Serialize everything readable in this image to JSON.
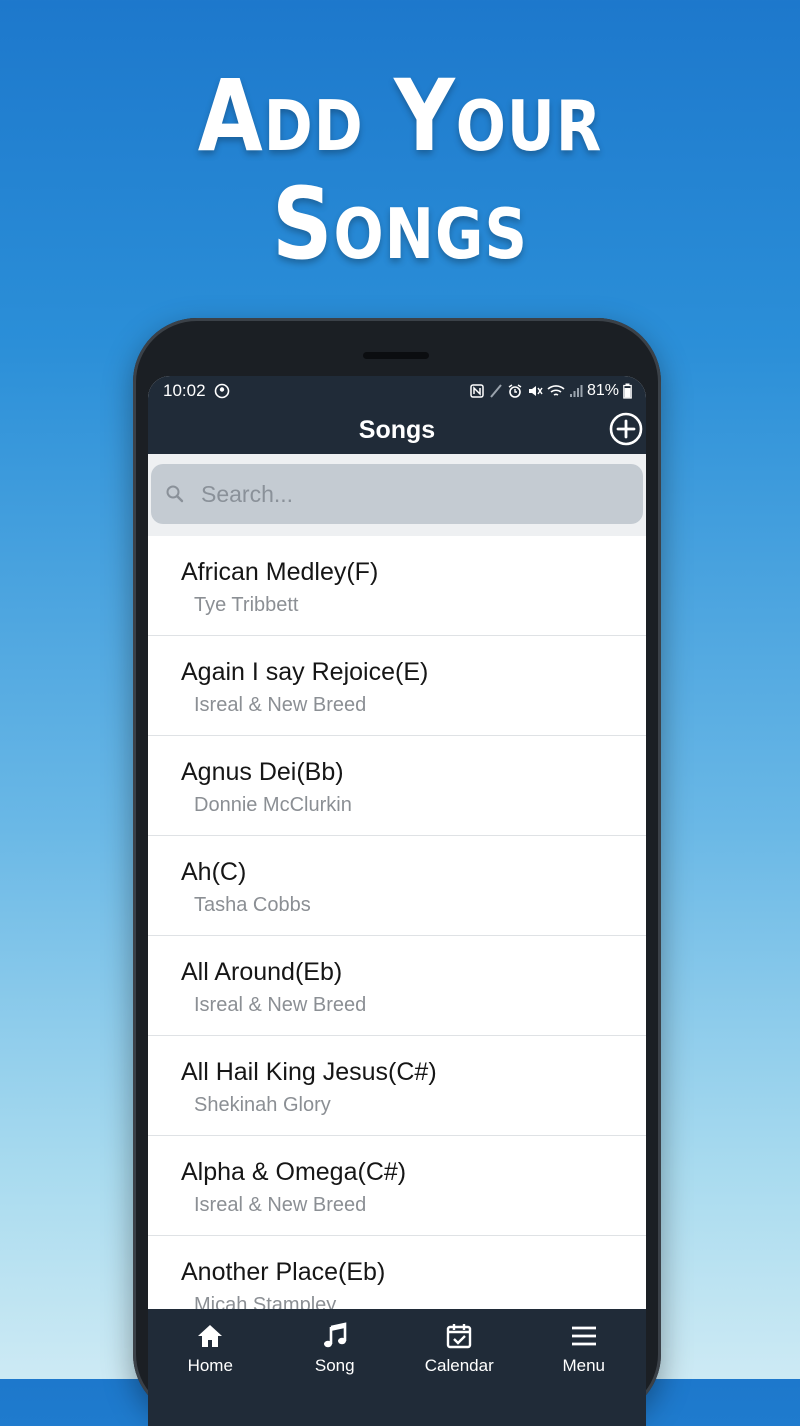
{
  "headline": {
    "line1": "Add Your",
    "line2": "Songs"
  },
  "status": {
    "time": "10:02",
    "battery": "81%"
  },
  "appbar": {
    "title": "Songs"
  },
  "search": {
    "placeholder": "Search..."
  },
  "songs": [
    {
      "title": "African Medley(F)",
      "artist": "Tye Tribbett"
    },
    {
      "title": "Again I say Rejoice(E)",
      "artist": "Isreal & New Breed"
    },
    {
      "title": "Agnus Dei(Bb)",
      "artist": "Donnie McClurkin"
    },
    {
      "title": "Ah(C)",
      "artist": "Tasha Cobbs"
    },
    {
      "title": "All Around(Eb)",
      "artist": "Isreal & New Breed"
    },
    {
      "title": "All Hail King Jesus(C#)",
      "artist": "Shekinah Glory"
    },
    {
      "title": "Alpha & Omega(C#)",
      "artist": "Isreal & New Breed"
    },
    {
      "title": "Another Place(Eb)",
      "artist": "Micah Stampley"
    }
  ],
  "nav": [
    {
      "label": "Home",
      "icon": "home-icon"
    },
    {
      "label": "Song",
      "icon": "music-note-icon"
    },
    {
      "label": "Calendar",
      "icon": "calendar-check-icon"
    },
    {
      "label": "Menu",
      "icon": "hamburger-menu-icon"
    }
  ],
  "colors": {
    "bar": "#202b38",
    "background_top": "#1d78cc",
    "background_bottom": "#cdeaf4"
  }
}
